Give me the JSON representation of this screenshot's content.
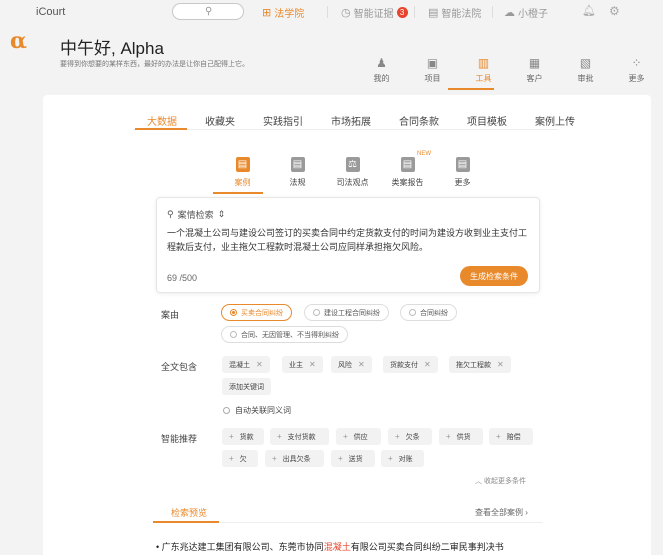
{
  "topbar": {
    "brand": "iCourt",
    "search_icon": "search-icon",
    "items": [
      {
        "label": "法学院",
        "icon": "book-icon",
        "glyph": "⊞",
        "active": true
      },
      {
        "label": "智能证据",
        "icon": "clock-icon",
        "glyph": "◷",
        "badge": "3"
      },
      {
        "label": "智能法院",
        "icon": "building-icon",
        "glyph": "▤"
      },
      {
        "label": "小橙子",
        "icon": "cloud-icon",
        "glyph": "☁"
      }
    ],
    "bell_icon": "bell-icon",
    "gear_icon": "gear-icon"
  },
  "header": {
    "logo": "α",
    "greeting": "中午好, Alpha",
    "motto": "要得到你想要的某样东西，最好的办法是让你自己配得上它。"
  },
  "modules": [
    {
      "label": "我的",
      "icon": "person-icon",
      "glyph": "♟"
    },
    {
      "label": "项目",
      "icon": "briefcase-icon",
      "glyph": "▣"
    },
    {
      "label": "工具",
      "icon": "toolbox-icon",
      "glyph": "▥",
      "active": true
    },
    {
      "label": "客户",
      "icon": "client-icon",
      "glyph": "▦"
    },
    {
      "label": "审批",
      "icon": "approval-icon",
      "glyph": "▧"
    },
    {
      "label": "更多",
      "icon": "grid-icon",
      "glyph": "⁘"
    }
  ],
  "tabs": [
    "大数据",
    "收藏夹",
    "实践指引",
    "市场拓展",
    "合同条款",
    "项目模板",
    "案例上传"
  ],
  "sub_tabs": [
    {
      "label": "案例",
      "icon": "case-icon",
      "glyph": "▤",
      "active": true
    },
    {
      "label": "法规",
      "icon": "law-icon",
      "glyph": "▤"
    },
    {
      "label": "司法观点",
      "icon": "gavel-icon",
      "glyph": "⚖"
    },
    {
      "label": "类案报告",
      "icon": "report-icon",
      "glyph": "▤",
      "new": "NEW"
    },
    {
      "label": "更多",
      "icon": "more-doc-icon",
      "glyph": "▤"
    }
  ],
  "query": {
    "label": "案情检索",
    "text": "一个混凝土公司与建设公司签订的买卖合同中约定货款支付的时间为建设方收到业主支付工程款后支付，业主拖欠工程款时混凝土公司应同样承担拖欠风险。",
    "count": "69",
    "max": "/500",
    "button": "生成检索条件"
  },
  "cause": {
    "label": "案由",
    "options": [
      {
        "label": "买卖合同纠纷",
        "selected": true
      },
      {
        "label": "建设工程合同纠纷"
      },
      {
        "label": "合同纠纷"
      },
      {
        "label": "合同、无因管理、不当得利纠纷"
      }
    ]
  },
  "fulltext": {
    "label": "全文包含",
    "chips": [
      "混凝土",
      "业主",
      "风险",
      "货款支付",
      "拖欠工程款"
    ],
    "add": "添加关键词",
    "synonym": "自动关联同义词"
  },
  "recommend": {
    "label": "智能推荐",
    "items": [
      "货款",
      "支付货款",
      "供应",
      "欠条",
      "供货",
      "赔偿",
      "欠",
      "出具欠条",
      "送货",
      "对账"
    ]
  },
  "collapse": "收起更多条件",
  "preview": {
    "tab": "检索预览",
    "view_all": "查看全部案例",
    "result_before": "广东兆达建工集团有限公司、东莞市协同",
    "result_highlight": "混凝土",
    "result_after": "有限公司买卖合同纠纷二审民事判决书"
  },
  "colors": {
    "accent": "#e8892c",
    "badge": "#e8432c"
  }
}
